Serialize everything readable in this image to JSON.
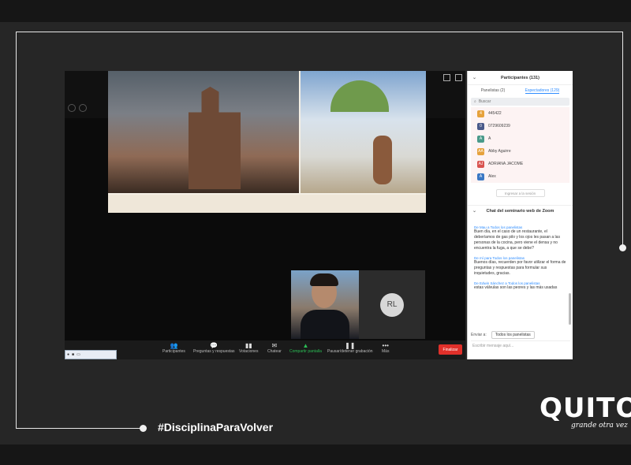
{
  "brand": {
    "hashtag": "#DisciplinaParaVolver",
    "logo_word": "QUITO",
    "logo_tagline": "grande otra vez"
  },
  "toolbar": {
    "items": [
      {
        "label": "Participantes",
        "count": "131",
        "icon": "participants-icon"
      },
      {
        "label": "Preguntas y respuestas",
        "icon": "qa-icon"
      },
      {
        "label": "Votaciones",
        "icon": "polls-icon"
      },
      {
        "label": "Chatear",
        "icon": "chat-icon"
      },
      {
        "label": "Compartir pantalla",
        "icon": "share-screen-icon"
      },
      {
        "label": "Pausar/detener grabación",
        "icon": "record-icon"
      },
      {
        "label": "Más",
        "icon": "more-icon"
      }
    ],
    "end_label": "Finalizar"
  },
  "video": {
    "remote_initials": "RL"
  },
  "participants": {
    "title": "Participantes (131)",
    "tabs": [
      "Panelistas (2)",
      "Espectadores (129)"
    ],
    "search_placeholder": "Buscar",
    "list": [
      {
        "initial": "4",
        "name": "445422",
        "color": "#e6a23c"
      },
      {
        "initial": "0",
        "name": "0729609239",
        "color": "#4a5a8a"
      },
      {
        "initial": "A",
        "name": "A",
        "color": "#4a9a8a"
      },
      {
        "initial": "AA",
        "name": "Abby Aguirre",
        "color": "#e6a23c"
      },
      {
        "initial": "AJ",
        "name": "ADRIANA JACOME",
        "color": "#d9534f"
      },
      {
        "initial": "A",
        "name": "Alex",
        "color": "#3b78c4"
      }
    ],
    "promote_label": "Ingresar a la sesión"
  },
  "chat": {
    "title": "Chat del seminario web de Zoom",
    "messages": [
      {
        "from": "De Mau a Todos los panelistas",
        "text": "Buen día, en el caso de un restaurante, el deberíamos de gas pilo y los ojos les pasan a las personas de la cocina, pero viene el densa y no encuentra la fuga, a que se debe?"
      },
      {
        "from": "De mí para Todos los panelistas",
        "text": "Buenos días, recuerden por favor utilizar el forma de preguntas y respuestas para formular sus inquietudes, gracias."
      },
      {
        "from": "De Edwin Sánchez a Todos los panelistas",
        "text": "estas válvulas son las peores y las más usadas"
      }
    ],
    "to_label": "Enviar a:",
    "to_value": "Todos los panelistas",
    "input_placeholder": "Escribir mensaje aquí..."
  }
}
